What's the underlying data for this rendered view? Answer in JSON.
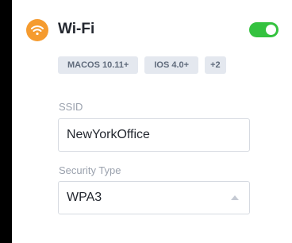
{
  "header": {
    "title": "Wi-Fi",
    "icon": "wifi-icon",
    "icon_color": "#f59b2f",
    "toggle_on": true,
    "toggle_color": "#34c23f"
  },
  "tags": {
    "macos": "MACOS 10.11+",
    "ios": "IOS 4.0+",
    "more": "+2"
  },
  "ssid": {
    "label": "SSID",
    "value": "NewYorkOffice"
  },
  "security": {
    "label": "Security Type",
    "value": "WPA3",
    "icon": "caret-up-icon"
  }
}
